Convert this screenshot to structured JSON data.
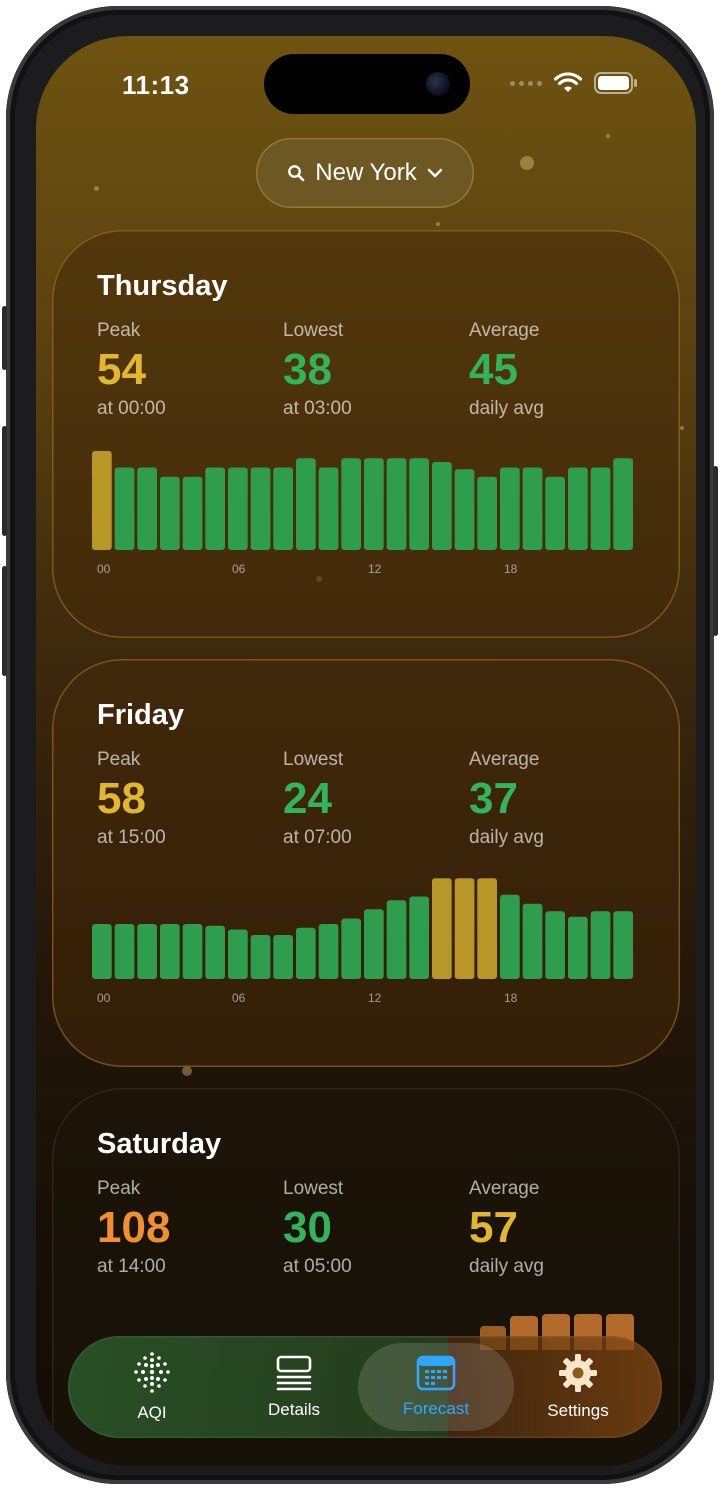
{
  "status": {
    "time": "11:13"
  },
  "search": {
    "city": "New York"
  },
  "colors": {
    "good": "#32b45a",
    "moderate": "#e2b62e",
    "unhealthy_sensitive": "#f0902e",
    "bar_good": "#2e9e4e",
    "bar_moderate": "#b99628",
    "bar_orange": "#b36a2a"
  },
  "days": [
    {
      "name": "Thursday",
      "peak": {
        "label": "Peak",
        "value": "54",
        "sub": "at 00:00",
        "color": "#e2b62e"
      },
      "lowest": {
        "label": "Lowest",
        "value": "38",
        "sub": "at 03:00",
        "color": "#32b45a"
      },
      "average": {
        "label": "Average",
        "value": "45",
        "sub": "daily avg",
        "color": "#32b45a"
      },
      "hourly": [
        54,
        45,
        45,
        40,
        40,
        45,
        45,
        45,
        45,
        50,
        45,
        50,
        50,
        50,
        50,
        48,
        44,
        40,
        45,
        45,
        40,
        45,
        45,
        50
      ],
      "ticks": [
        "00",
        "06",
        "12",
        "18"
      ]
    },
    {
      "name": "Friday",
      "peak": {
        "label": "Peak",
        "value": "58",
        "sub": "at 15:00",
        "color": "#e2b62e"
      },
      "lowest": {
        "label": "Lowest",
        "value": "24",
        "sub": "at 07:00",
        "color": "#32b45a"
      },
      "average": {
        "label": "Average",
        "value": "37",
        "sub": "daily avg",
        "color": "#32b45a"
      },
      "hourly": [
        30,
        30,
        30,
        30,
        30,
        29,
        27,
        24,
        24,
        28,
        30,
        33,
        38,
        43,
        45,
        55,
        55,
        55,
        46,
        41,
        37,
        34,
        37,
        37
      ],
      "ticks": [
        "00",
        "06",
        "12",
        "18"
      ]
    },
    {
      "name": "Saturday",
      "peak": {
        "label": "Peak",
        "value": "108",
        "sub": "at 14:00",
        "color": "#f0902e"
      },
      "lowest": {
        "label": "Lowest",
        "value": "30",
        "sub": "at 05:00",
        "color": "#32b45a"
      },
      "average": {
        "label": "Average",
        "value": "57",
        "sub": "daily avg",
        "color": "#e2b62e"
      }
    }
  ],
  "tabs": [
    {
      "label": "AQI",
      "icon": "aqi-dots-icon",
      "active": false
    },
    {
      "label": "Details",
      "icon": "list-icon",
      "active": false
    },
    {
      "label": "Forecast",
      "icon": "calendar-icon",
      "active": true
    },
    {
      "label": "Settings",
      "icon": "gear-icon",
      "active": false
    }
  ]
}
